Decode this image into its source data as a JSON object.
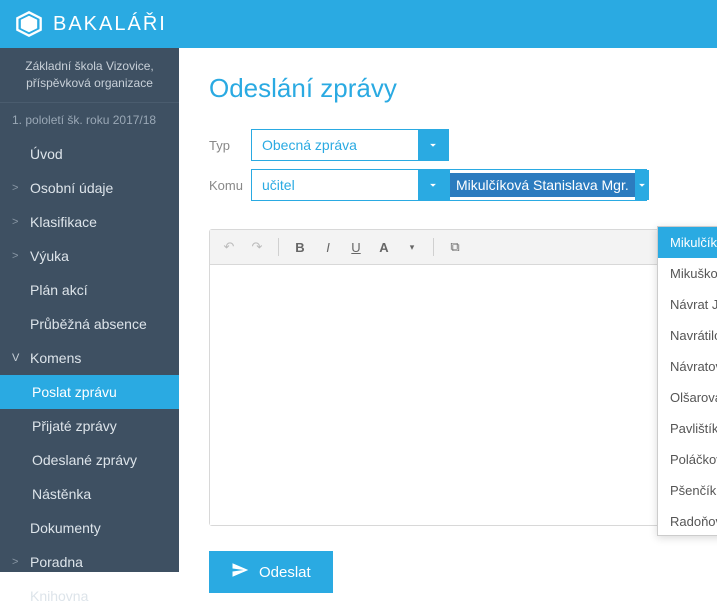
{
  "app": {
    "name": "BAKALÁŘI"
  },
  "school": {
    "name": "Základní škola Vizovice,\npříspěvková organizace",
    "semester": "1. pololetí šk. roku 2017/18"
  },
  "nav": {
    "items": [
      {
        "label": "Úvod",
        "chev": ""
      },
      {
        "label": "Osobní údaje",
        "chev": ">"
      },
      {
        "label": "Klasifikace",
        "chev": ">"
      },
      {
        "label": "Výuka",
        "chev": ">"
      },
      {
        "label": "Plán akcí",
        "chev": ""
      },
      {
        "label": "Průběžná absence",
        "chev": ""
      },
      {
        "label": "Komens",
        "chev": "V"
      },
      {
        "label": "Poslat zprávu",
        "sub": true
      },
      {
        "label": "Přijaté zprávy",
        "sub": true
      },
      {
        "label": "Odeslané zprávy",
        "sub": true
      },
      {
        "label": "Nástěnka",
        "sub": true
      },
      {
        "label": "Dokumenty",
        "chev": ""
      },
      {
        "label": "Poradna",
        "chev": ">"
      },
      {
        "label": "Knihovna",
        "chev": ""
      }
    ]
  },
  "page": {
    "title": "Odeslání zprávy",
    "type_label": "Typ",
    "recipient_label": "Komu",
    "type_value": "Obecná zpráva",
    "role_value": "učitel",
    "person_value": "Mikulčíková Stanislava Mgr.",
    "send_button": "Odeslat"
  },
  "dropdown": {
    "items": [
      "Mikulčíková Stanislava Mgr.",
      "Mikušková Zuzana Mgr.",
      "Návrat Jindřich Mgr.",
      "Navrátilová Lucie Mgr.",
      "Návratová Helena Mgr.",
      "Olšarová Anna",
      "Pavlištíková Petra Mgr.",
      "Poláčková Marie Mgr.",
      "Pšenčík Josef",
      "Radoňová Hana"
    ],
    "selected_index": 0
  }
}
